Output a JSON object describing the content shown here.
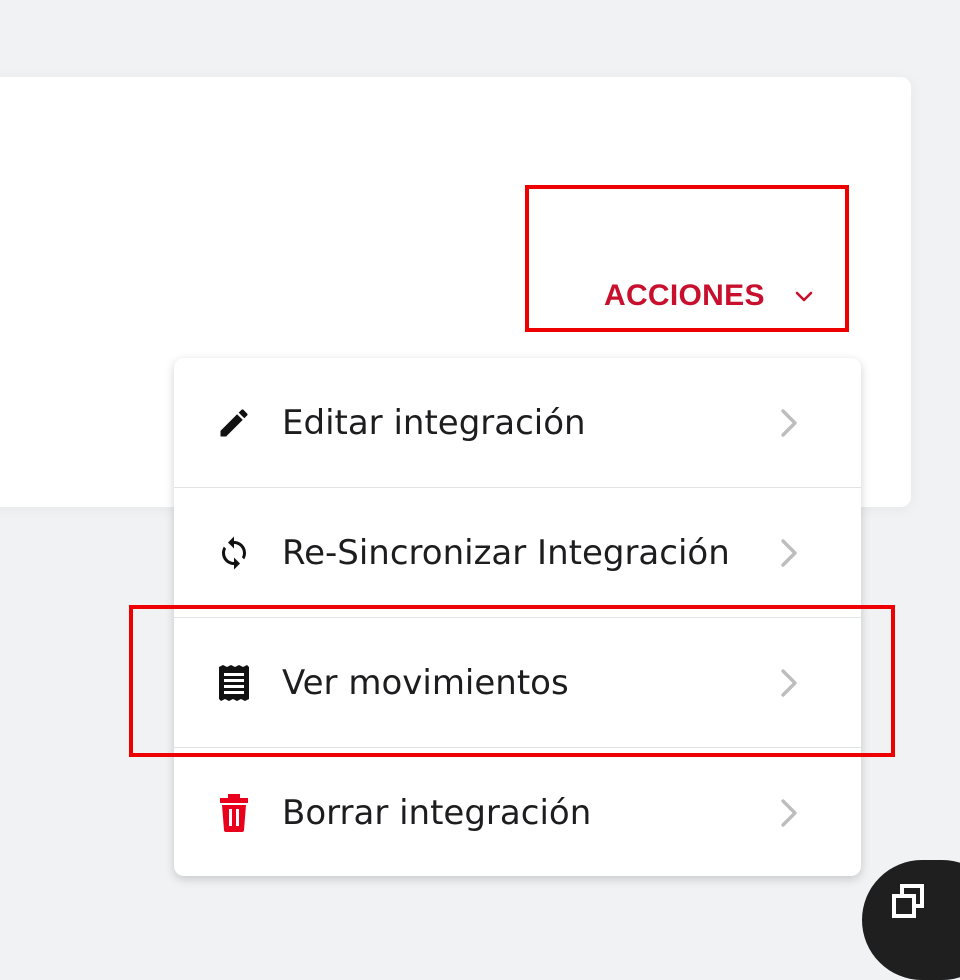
{
  "header": {
    "actions_label": "ACCIONES"
  },
  "menu": {
    "items": [
      {
        "label": "Editar integración",
        "icon": "pencil-icon"
      },
      {
        "label": "Re-Sincronizar Integración",
        "icon": "sync-icon"
      },
      {
        "label": "Ver movimientos",
        "icon": "receipt-icon"
      },
      {
        "label": "Borrar integración",
        "icon": "trash-icon"
      }
    ]
  },
  "colors": {
    "accent": "#c8102e",
    "highlight": "#ee0000",
    "delete_icon": "#e8001c",
    "chevron": "#bdbdbd"
  },
  "fab": {
    "icon": "copy-icon"
  }
}
